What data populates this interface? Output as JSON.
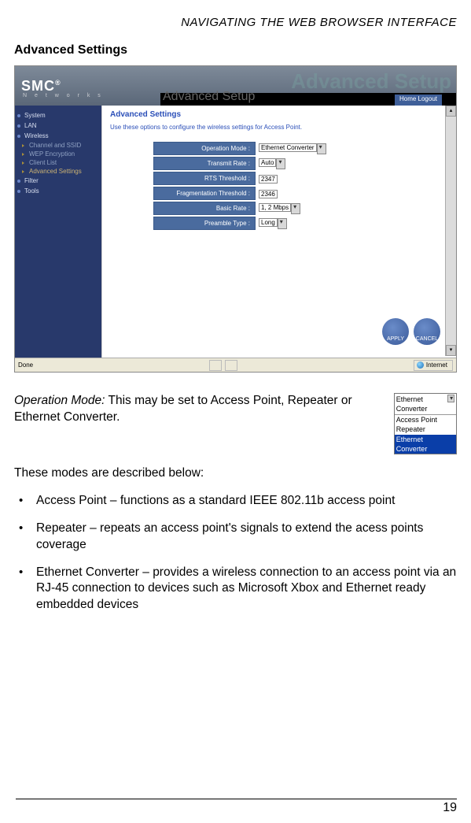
{
  "header": "NAVIGATING THE WEB BROWSER INTERFACE",
  "section_title": "Advanced Settings",
  "screenshot": {
    "logo": "SMC",
    "logo_sub": "N e t w o r k s",
    "watermark": "Advanced Setup",
    "tab_label": "Advanced Setup",
    "topbar_right": "Home   Logout",
    "sidebar": {
      "top": [
        "System",
        "LAN",
        "Wireless"
      ],
      "subs": [
        "Channel and SSID",
        "WEP Encryption",
        "Client List",
        "Advanced Settings"
      ],
      "bottom": [
        "Filter",
        "Tools"
      ]
    },
    "main_title": "Advanced Settings",
    "main_desc": "Use these options to configure the wireless settings for Access Point.",
    "rows": [
      {
        "label": "Operation Mode :",
        "value": "Ethernet Converter",
        "type": "select",
        "cls": "w1"
      },
      {
        "label": "Transmit Rate :",
        "value": "Auto",
        "type": "select",
        "cls": "w2"
      },
      {
        "label": "RTS Threshold :",
        "value": "2347",
        "type": "input"
      },
      {
        "label": "Fragmentation Threshold :",
        "value": "2346",
        "type": "input"
      },
      {
        "label": "Basic Rate :",
        "value": "1, 2 Mbps",
        "type": "select",
        "cls": "w3"
      },
      {
        "label": "Preamble Type :",
        "value": "Long",
        "type": "select",
        "cls": "w4"
      }
    ],
    "btn_apply": "APPLY",
    "btn_cancel": "CANCEL",
    "status_left": "Done",
    "status_right": "Internet"
  },
  "opmode": {
    "lead": "Operation Mode:",
    "text": " This may be set to Access Point, Repeater or Ethernet Converter.",
    "dropdown_top": "Ethernet Converter",
    "options": [
      "Access Point",
      "Repeater",
      "Ethernet Converter"
    ]
  },
  "modes_intro": "These modes are described below:",
  "bullets": [
    "Access Point – functions as a standard IEEE 802.11b access point",
    "Repeater – repeats an access point's signals to extend the acess points coverage",
    "Ethernet Converter – provides a wireless connection to an access point via an RJ-45 connection to devices such as Microsoft Xbox and Ethernet ready embedded devices"
  ],
  "page_num": "19"
}
